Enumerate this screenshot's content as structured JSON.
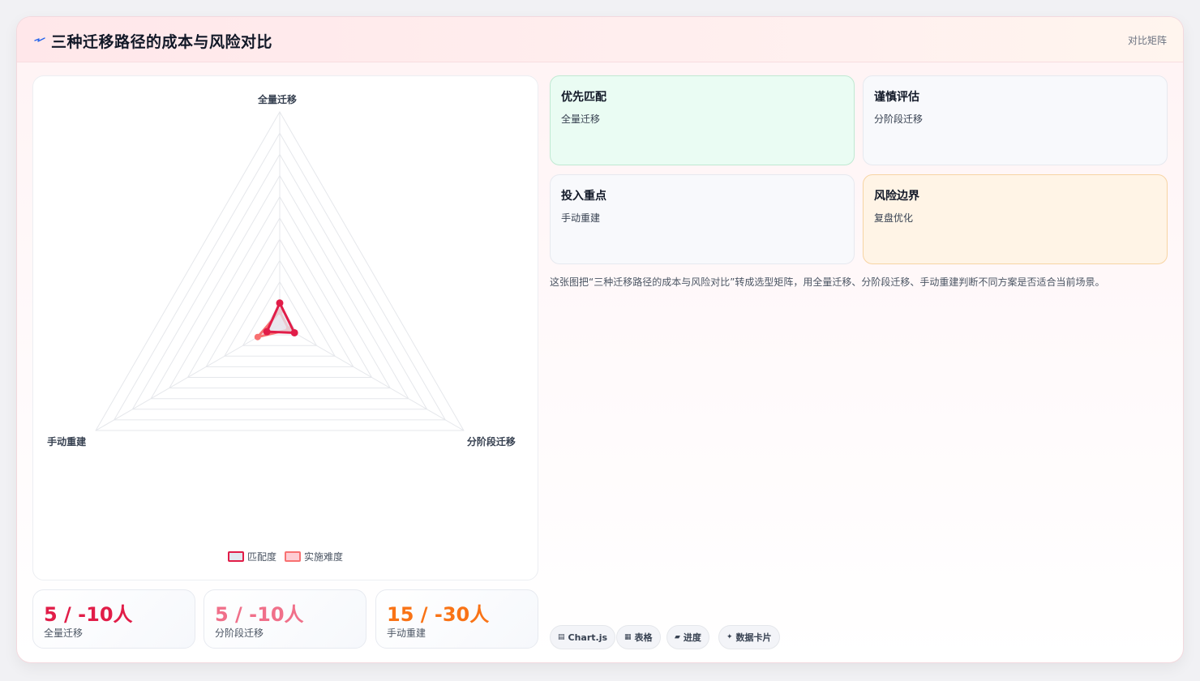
{
  "header": {
    "title": "三种迁移路径的成本与风险对比",
    "tag": "对比矩阵",
    "icon": "bolt-icon"
  },
  "chart_data": {
    "type": "radar",
    "axes": [
      "全量迁移",
      "分阶段迁移",
      "手动重建"
    ],
    "rmax": 10,
    "rings": 10,
    "series": [
      {
        "name": "匹配度",
        "values": [
          1.0,
          0.8,
          0.7
        ],
        "color": "#e11d48",
        "fill": "#e2e8f0"
      },
      {
        "name": "实施难度",
        "values": [
          0.6,
          0.5,
          1.2
        ],
        "color": "#f87171",
        "fill": "#fecdd3"
      }
    ],
    "legend_position": "bottom"
  },
  "stats": [
    {
      "value": "5 / -10人",
      "label": "全量迁移",
      "color": "#e11d48"
    },
    {
      "value": "5 / -10人",
      "label": "分阶段迁移",
      "color": "#f0708a"
    },
    {
      "value": "15 / -30人",
      "label": "手动重建",
      "color": "#f97316"
    }
  ],
  "matrix": [
    {
      "title": "优先匹配",
      "value": "全量迁移",
      "tone": "green"
    },
    {
      "title": "谨慎评估",
      "value": "分阶段迁移",
      "tone": "neutral"
    },
    {
      "title": "投入重点",
      "value": "手动重建",
      "tone": "neutral"
    },
    {
      "title": "风险边界",
      "value": "复盘优化",
      "tone": "amber"
    }
  ],
  "description": "这张图把“三种迁移路径的成本与风险对比”转成选型矩阵，用全量迁移、分阶段迁移、手动重建判断不同方案是否适合当前场景。",
  "chips": [
    {
      "icon": "▤",
      "label": "Chart.js",
      "icon_name": "chart-icon"
    },
    {
      "icon": "▦",
      "label": "表格",
      "icon_name": "table-icon"
    },
    {
      "icon": "▰",
      "label": "进度",
      "icon_name": "progress-icon"
    },
    {
      "icon": "✦",
      "label": "数据卡片",
      "icon_name": "sparkle-icon"
    }
  ]
}
